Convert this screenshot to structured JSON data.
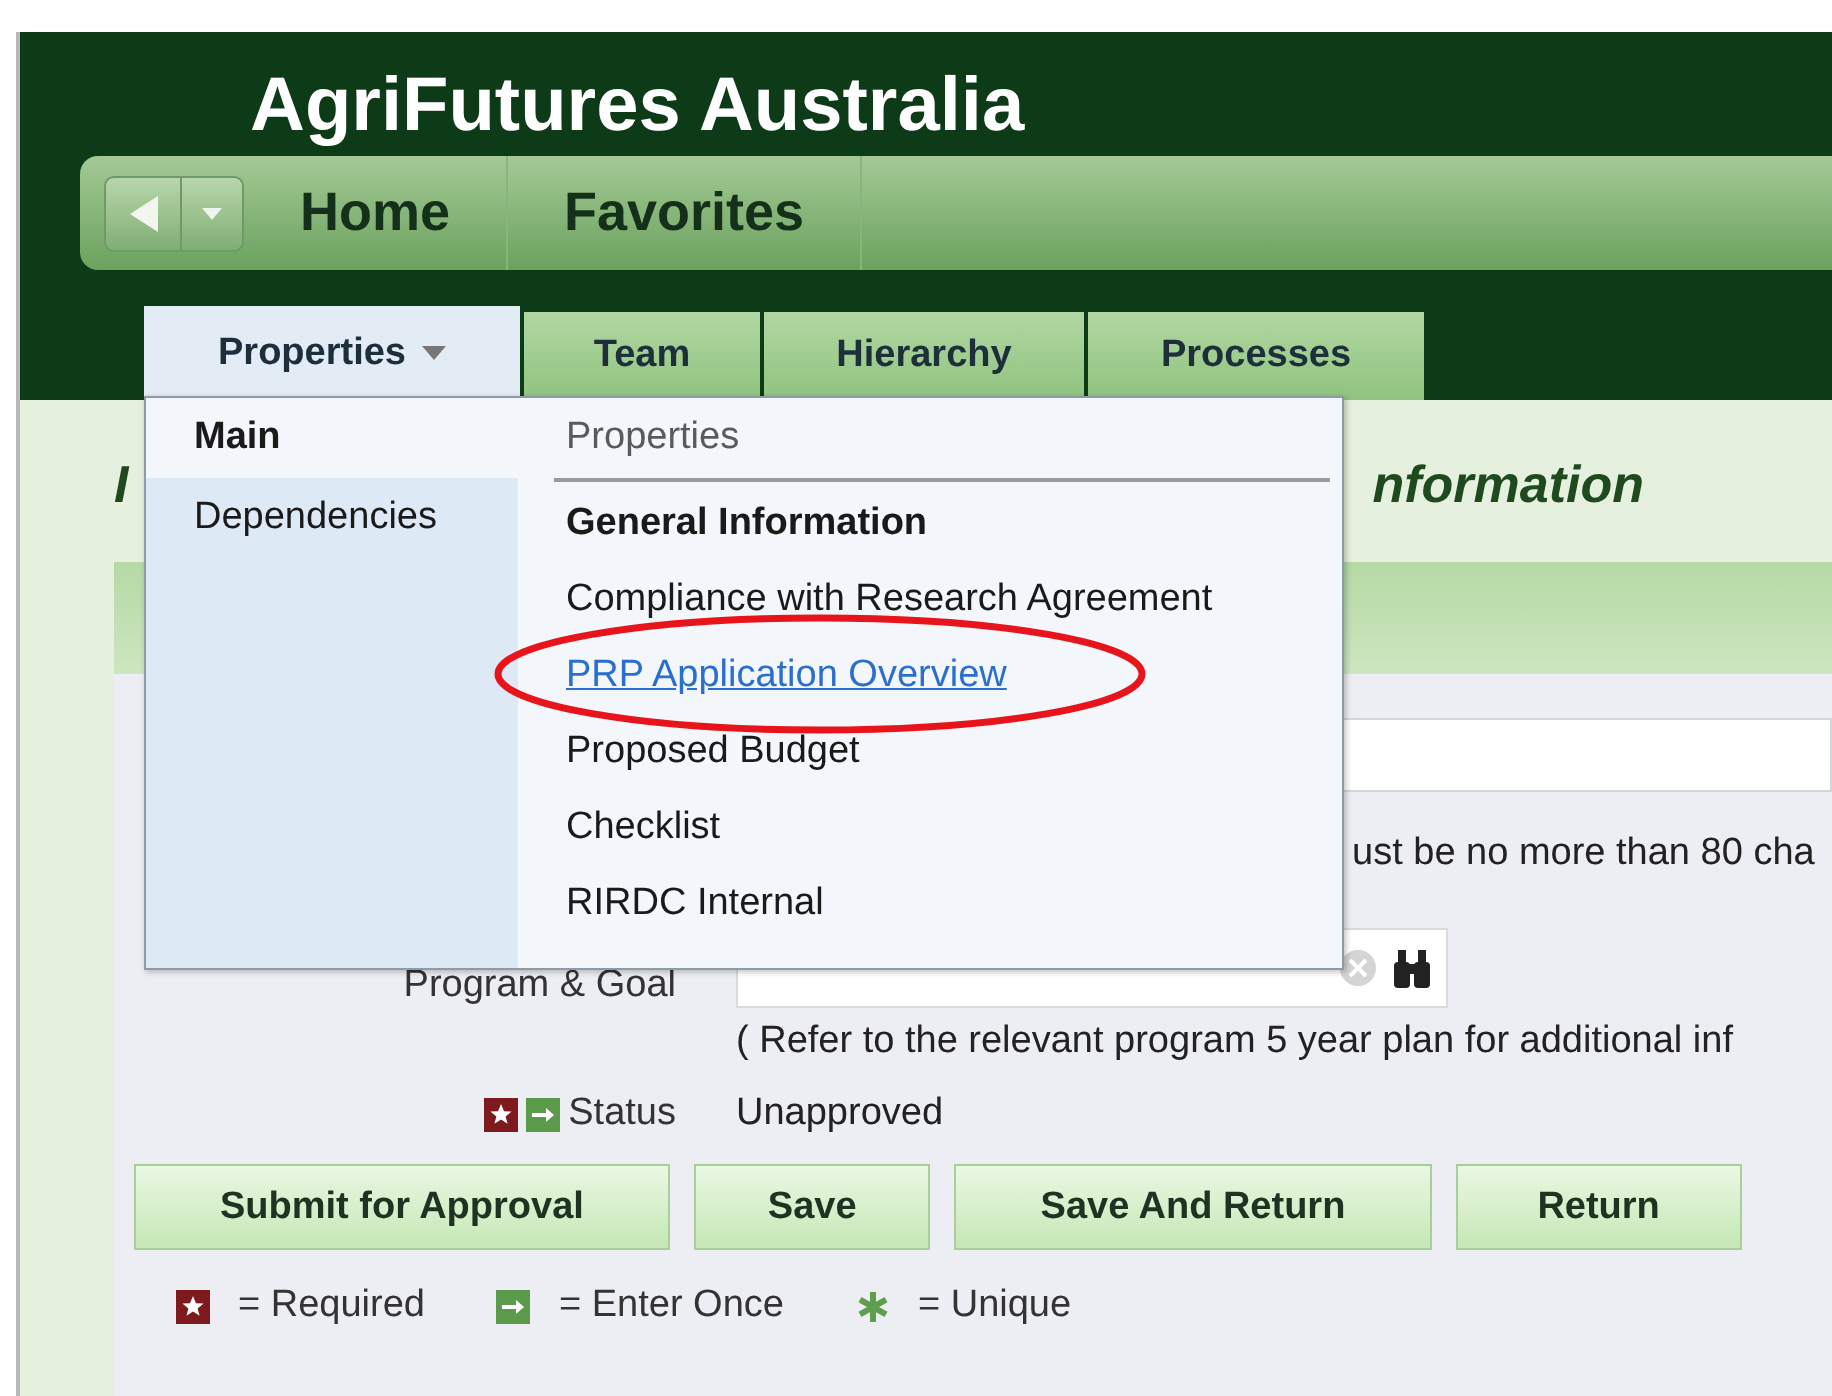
{
  "app": {
    "title": "AgriFutures Australia"
  },
  "nav": {
    "items": [
      {
        "label": "Home"
      },
      {
        "label": "Favorites"
      }
    ]
  },
  "tabs": [
    {
      "label": "Properties",
      "selected": true,
      "has_menu": true
    },
    {
      "label": "Team",
      "selected": false,
      "has_menu": false
    },
    {
      "label": "Hierarchy",
      "selected": false,
      "has_menu": false
    },
    {
      "label": "Processes",
      "selected": false,
      "has_menu": false
    }
  ],
  "page_heading": {
    "left": "I",
    "right": "nformation"
  },
  "form": {
    "name_hint": "ust be no more than 80 cha",
    "program_label": "Program & Goal",
    "program_help": "( Refer to the relevant program 5 year plan for additional inf",
    "status_required": true,
    "status_enter_once": true,
    "status_label": "Status",
    "status_value": "Unapproved"
  },
  "buttons": [
    {
      "label": "Submit for Approval"
    },
    {
      "label": "Save"
    },
    {
      "label": "Save And Return"
    },
    {
      "label": "Return"
    }
  ],
  "legend": [
    {
      "kind": "required",
      "label": "= Required"
    },
    {
      "kind": "enter_once",
      "label": "= Enter Once"
    },
    {
      "kind": "unique",
      "label": "= Unique"
    }
  ],
  "menu": {
    "sections": [
      {
        "label": "Main",
        "selected": true
      },
      {
        "label": "Dependencies",
        "selected": false
      }
    ],
    "header": "Properties",
    "items": [
      {
        "label": "General Information",
        "current": true,
        "hovered": false,
        "circled": false
      },
      {
        "label": "Compliance with Research Agreement",
        "current": false,
        "hovered": false,
        "circled": false
      },
      {
        "label": "PRP Application Overview",
        "current": false,
        "hovered": true,
        "circled": true
      },
      {
        "label": "Proposed Budget",
        "current": false,
        "hovered": false,
        "circled": false
      },
      {
        "label": "Checklist",
        "current": false,
        "hovered": false,
        "circled": false
      },
      {
        "label": "RIRDC Internal",
        "current": false,
        "hovered": false,
        "circled": false
      }
    ]
  }
}
